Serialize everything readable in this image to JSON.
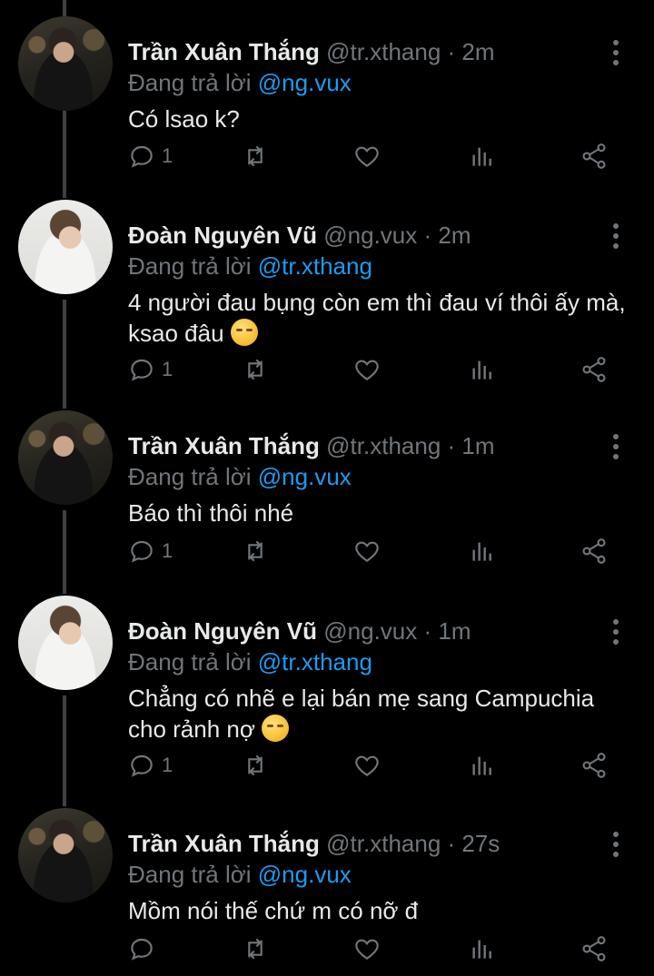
{
  "tweets": [
    {
      "name": "Trần Xuân Thắng",
      "handle": "@tr.xthang · 2m",
      "reply_prefix": "Đang trả lời ",
      "reply_to": "@ng.vux",
      "text": "Có lsao k?",
      "emoji": "",
      "reply_count": "1"
    },
    {
      "name": "Đoàn Nguyên Vũ",
      "handle": "@ng.vux · 2m",
      "reply_prefix": "Đang trả lời ",
      "reply_to": "@tr.xthang",
      "text": "4 người đau bụng còn em thì đau ví thôi ấy mà, ksao đâu ",
      "emoji": "face-with-rolling-eyes-emoji",
      "reply_count": "1"
    },
    {
      "name": "Trần Xuân Thắng",
      "handle": "@tr.xthang · 1m",
      "reply_prefix": "Đang trả lời ",
      "reply_to": "@ng.vux",
      "text": "Báo thì thôi nhé",
      "emoji": "",
      "reply_count": "1"
    },
    {
      "name": "Đoàn Nguyên Vũ",
      "handle": "@ng.vux · 1m",
      "reply_prefix": "Đang trả lời ",
      "reply_to": "@tr.xthang",
      "text": "Chẳng có nhẽ e lại bán mẹ sang Campuchia cho rảnh nợ ",
      "emoji": "smiling-face-emoji",
      "reply_count": "1"
    },
    {
      "name": "Trần Xuân Thắng",
      "handle": "@tr.xthang · 27s",
      "reply_prefix": "Đang trả lời ",
      "reply_to": "@ng.vux",
      "text": "Mồm nói thế chứ m có nỡ đ",
      "emoji": "",
      "reply_count": ""
    }
  ],
  "colors": {
    "background": "#000000",
    "text": "#e7e9ea",
    "muted": "#71767b",
    "link": "#1d9bf0",
    "thread_line": "#3e4144"
  }
}
